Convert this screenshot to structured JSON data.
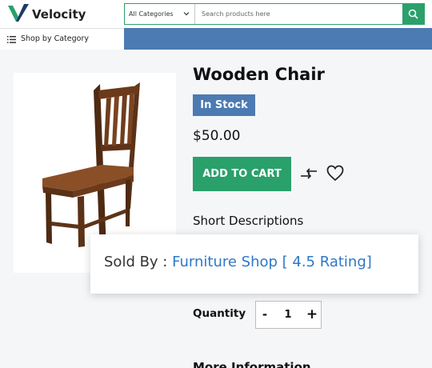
{
  "header": {
    "brand": "Velocity",
    "logo_icon": "velocity-v-logo",
    "category_select": "All Categories",
    "search_placeholder": "Search products here",
    "search_icon": "search-icon"
  },
  "nav": {
    "shop_by_category": "Shop by Category",
    "menu_icon": "list-icon"
  },
  "product": {
    "title": "Wooden Chair",
    "stock_badge": "In Stock",
    "price": "$50.00",
    "add_to_cart": "ADD TO CART",
    "compare_icon": "compare-icon",
    "wishlist_icon": "heart-icon",
    "short_descriptions": "Short Descriptions",
    "quantity_label": "Quantity",
    "quantity_minus": "-",
    "quantity_value": "1",
    "quantity_plus": "+",
    "more_information": "More Information"
  },
  "seller": {
    "prefix": "Sold By : ",
    "link": "Furniture Shop [ 4.5 Rating]"
  },
  "colors": {
    "accent_green": "#2aa06b",
    "accent_blue": "#4c7ab2",
    "link_blue": "#2e78c7"
  }
}
